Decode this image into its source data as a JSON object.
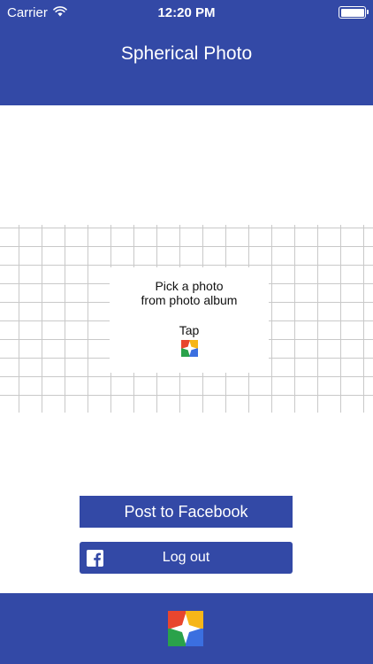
{
  "status_bar": {
    "carrier": "Carrier",
    "time": "12:20 PM",
    "wifi_icon": "wifi-icon",
    "battery_icon": "battery-icon"
  },
  "nav": {
    "title": "Spherical Photo"
  },
  "picker": {
    "line1": "Pick a photo",
    "line2": "from photo album",
    "tap_label": "Tap",
    "icon": "photos-icon"
  },
  "buttons": {
    "post_facebook": "Post to Facebook",
    "logout": "Log out",
    "logout_icon": "facebook-icon"
  },
  "bottom_bar": {
    "icon": "photos-icon"
  },
  "colors": {
    "brand_blue": "#3349a6",
    "grid_line": "#c9c9c9",
    "white": "#ffffff"
  }
}
